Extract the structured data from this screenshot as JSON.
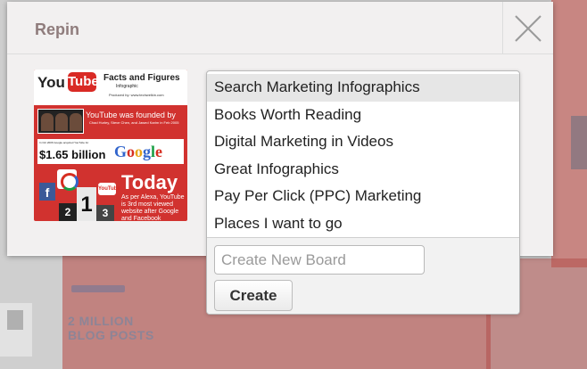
{
  "modal": {
    "title": "Repin",
    "close_icon": "close-icon"
  },
  "pin": {
    "logo_you": "You",
    "logo_tube": "Tube",
    "heading": "Facts and Figures",
    "subheading": "Infographic",
    "produced_by": "Produced by: www.techwelkin.com",
    "founded": "YouTube was founded by",
    "founders": "Chad Hurley, Steve Chen, and Jawed Karim in Feb 2005",
    "acquired_note": "In Oct 2006 Google acquired YouTube for",
    "price": "$1.65 billion",
    "google": [
      "G",
      "o",
      "o",
      "g",
      "l",
      "e"
    ],
    "facebook": "f",
    "rank_1": "1",
    "rank_2": "2",
    "rank_3": "3",
    "youtube_small": "YouTube",
    "today": "Today",
    "alexa": "As per Alexa, YouTube is 3rd most viewed website after Google and Facebook"
  },
  "boards": {
    "items": [
      {
        "label": "Search Marketing Infographics",
        "selected": true
      },
      {
        "label": "Books Worth Reading",
        "selected": false
      },
      {
        "label": "Digital Marketing in Videos",
        "selected": false
      },
      {
        "label": "Great Infographics",
        "selected": false
      },
      {
        "label": "Pay Per Click (PPC) Marketing",
        "selected": false
      },
      {
        "label": "Places I want to go",
        "selected": false
      }
    ],
    "new_board_placeholder": "Create New Board",
    "create_label": "Create"
  },
  "background": {
    "stat_text_line1": "2 MILLION",
    "stat_text_line2": "BLOG POSTS"
  }
}
